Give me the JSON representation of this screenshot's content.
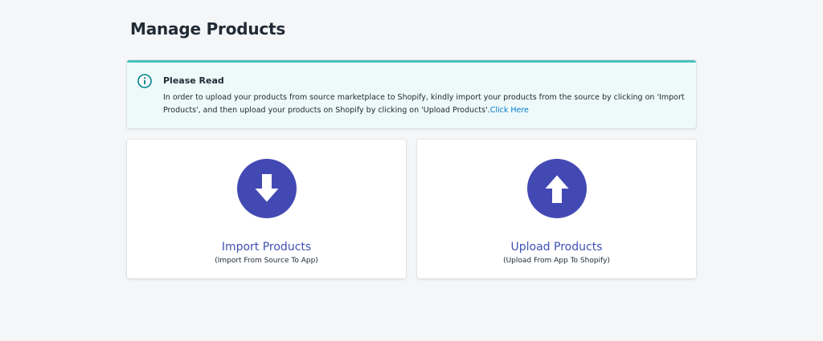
{
  "page": {
    "title": "Manage Products"
  },
  "banner": {
    "icon": "info-icon",
    "title": "Please Read",
    "text": "In order to upload your products from source marketplace to Shopify, kindly import your products from the source by clicking on 'Import Products', and then upload your products on Shopify by clicking on 'Upload Products'.",
    "link_text": "Click Here",
    "accent_color": "#47c1bf",
    "background_color": "#eef9f9"
  },
  "cards": {
    "import": {
      "icon": "arrow-down-icon",
      "title": "Import Products",
      "subtitle": "(Import From Source To App)"
    },
    "upload": {
      "icon": "arrow-up-icon",
      "title": "Upload Products",
      "subtitle": "(Upload From App To Shopify)"
    },
    "icon_color": "#4349b3"
  }
}
